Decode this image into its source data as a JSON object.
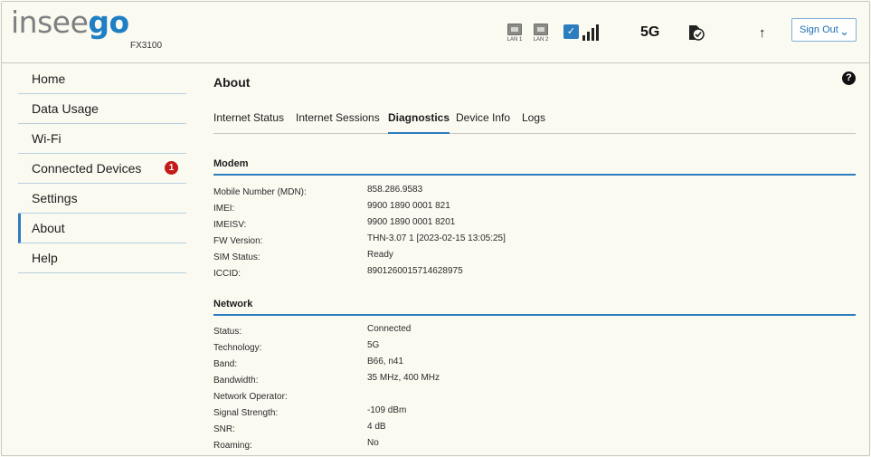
{
  "header": {
    "logo_part1": "insee",
    "logo_part2": "go",
    "model": "FX3100",
    "lan1_label": "LAN 1",
    "lan2_label": "LAN 2",
    "network_type": "5G",
    "sign_out_label": "Sign Out",
    "accent_color": "#2c7cc0"
  },
  "sidebar": {
    "items": [
      {
        "label": "Home"
      },
      {
        "label": "Data Usage"
      },
      {
        "label": "Wi-Fi"
      },
      {
        "label": "Connected Devices",
        "badge": "1"
      },
      {
        "label": "Settings"
      },
      {
        "label": "About"
      },
      {
        "label": "Help"
      }
    ],
    "active_index": 5
  },
  "main": {
    "title": "About",
    "help_glyph": "?",
    "tabs": [
      {
        "label": "Internet Status"
      },
      {
        "label": "Internet Sessions"
      },
      {
        "label": "Diagnostics"
      },
      {
        "label": "Device Info"
      },
      {
        "label": "Logs"
      }
    ],
    "active_tab_index": 2,
    "modem": {
      "title": "Modem",
      "rows": [
        {
          "key": "Mobile Number (MDN):",
          "value": "858.286.9583"
        },
        {
          "key": "IMEI:",
          "value": "9900 1890 0001 821"
        },
        {
          "key": "IMEISV:",
          "value": "9900 1890 0001 8201"
        },
        {
          "key": "FW Version:",
          "value": "THN-3.07 1 [2023-02-15 13:05:25]"
        },
        {
          "key": "SIM Status:",
          "value": "Ready"
        },
        {
          "key": "ICCID:",
          "value": "8901260015714628975"
        }
      ]
    },
    "network": {
      "title": "Network",
      "rows": [
        {
          "key": "Status:",
          "value": "Connected"
        },
        {
          "key": "Technology:",
          "value": "5G"
        },
        {
          "key": "Band:",
          "value": "B66, n41"
        },
        {
          "key": "Bandwidth:",
          "value": "35 MHz, 400 MHz"
        },
        {
          "key": "Network Operator:",
          "value": ""
        },
        {
          "key": "Signal Strength:",
          "value": "-109 dBm"
        },
        {
          "key": "SNR:",
          "value": "4 dB"
        },
        {
          "key": "Roaming:",
          "value": "No"
        }
      ]
    }
  }
}
